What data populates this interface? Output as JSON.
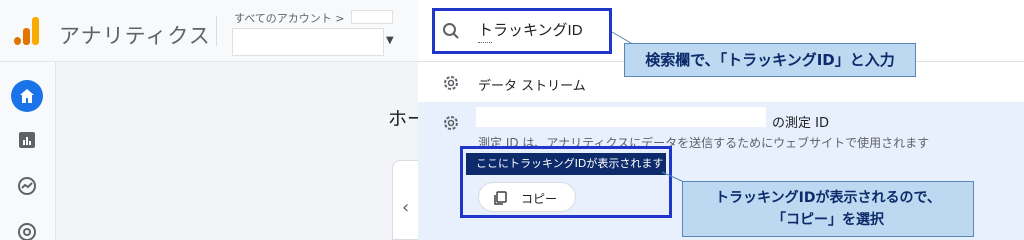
{
  "app": {
    "title": "アナリティクス",
    "account_caption": "すべてのアカウント >",
    "home_heading": "ホー"
  },
  "nav": {
    "icons": [
      "home-icon",
      "reports-icon",
      "explore-icon",
      "advertising-icon"
    ]
  },
  "search": {
    "value": "トラッキングID",
    "icon": "search-icon"
  },
  "results": [
    {
      "label": "データ ストリーム",
      "icon": "gear-icon"
    },
    {
      "suffix": "の測定 ID",
      "description": "測定 ID は、アナリティクスにデータを送信するためにウェブサイトで使用されます",
      "icon": "gear-icon"
    }
  ],
  "tracking_id_chip": "ここにトラッキングIDが表示されます",
  "copy_button": {
    "label": "コピー",
    "icon": "copy-icon"
  },
  "annotations": {
    "search_note": "検索欄で、「トラッキングID」と入力",
    "copy_note_line1": "トラッキングIDが表示されるので、",
    "copy_note_line2": "「コピー」を選択"
  },
  "colors": {
    "highlight_border": "#2036c8",
    "callout_fill": "#bcd9f1",
    "callout_text": "#0d2a6a",
    "chip_fill": "#0d2a6a",
    "selected_row": "#e8f0fe",
    "brand_orange": "#e37400",
    "brand_yellow": "#f9ab00",
    "nav_active": "#1a73e8"
  }
}
